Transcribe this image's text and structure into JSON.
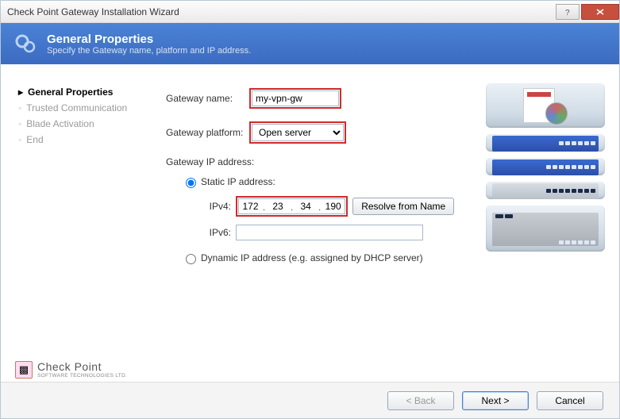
{
  "window": {
    "title": "Check Point Gateway Installation Wizard"
  },
  "header": {
    "title": "General Properties",
    "subtitle": "Specify the Gateway name, platform and IP address."
  },
  "steps": [
    {
      "label": "General Properties",
      "active": true
    },
    {
      "label": "Trusted Communication",
      "active": false
    },
    {
      "label": "Blade Activation",
      "active": false
    },
    {
      "label": "End",
      "active": false
    }
  ],
  "branding": {
    "name": "Check Point",
    "tagline": "SOFTWARE TECHNOLOGIES LTD."
  },
  "form": {
    "gateway_name_label": "Gateway name:",
    "gateway_name_value": "my-vpn-gw",
    "gateway_platform_label": "Gateway platform:",
    "gateway_platform_value": "Open server",
    "ip_section_label": "Gateway IP address:",
    "static_label": "Static IP address:",
    "dynamic_label": "Dynamic IP address (e.g. assigned by DHCP server)",
    "ip_mode": "static",
    "ipv4_label": "IPv4:",
    "ipv4": {
      "a": "172",
      "b": "23",
      "c": "34",
      "d": "190"
    },
    "ipv6_label": "IPv6:",
    "ipv6_value": "",
    "resolve_btn": "Resolve from Name"
  },
  "footer": {
    "back": "< Back",
    "next": "Next >",
    "cancel": "Cancel"
  }
}
